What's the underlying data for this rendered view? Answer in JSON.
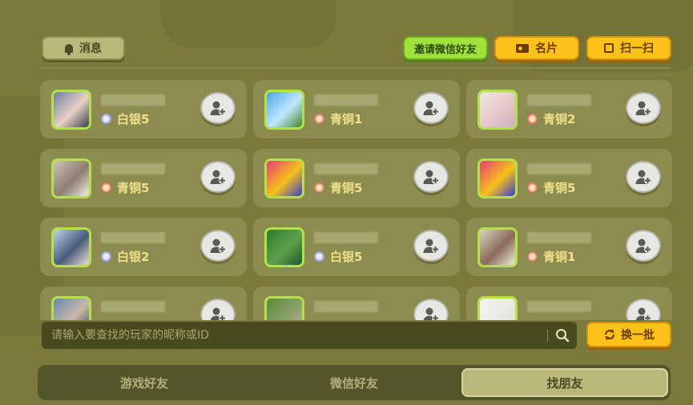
{
  "header": {
    "message_label": "消息",
    "invite_wechat_label": "邀请微信好友",
    "card_label": "名片",
    "scan_label": "扫一扫"
  },
  "friends": [
    {
      "rank": "白银5",
      "rank_type": "silver",
      "avatar_colors": [
        "#6e7fa2",
        "#e8d0c4",
        "#3b3d4d"
      ]
    },
    {
      "rank": "青铜1",
      "rank_type": "bronze",
      "avatar_colors": [
        "#4aa6e8",
        "#bfe8ff",
        "#3f8a2a"
      ]
    },
    {
      "rank": "青铜2",
      "rank_type": "bronze",
      "avatar_colors": [
        "#f0e8e4",
        "#e8c8c8",
        "#c8b0c0"
      ]
    },
    {
      "rank": "青铜5",
      "rank_type": "bronze",
      "avatar_colors": [
        "#cfc5b8",
        "#8c7e70",
        "#f2ece6"
      ]
    },
    {
      "rank": "青铜5",
      "rank_type": "bronze",
      "avatar_colors": [
        "#e83a7a",
        "#f6c21a",
        "#3a3ad0"
      ]
    },
    {
      "rank": "青铜5",
      "rank_type": "bronze",
      "avatar_colors": [
        "#e83a7a",
        "#f6c21a",
        "#3a3ad0"
      ]
    },
    {
      "rank": "白银2",
      "rank_type": "silver",
      "avatar_colors": [
        "#bcd8ec",
        "#4a5a7a",
        "#e8e0d8"
      ]
    },
    {
      "rank": "白银5",
      "rank_type": "silver",
      "avatar_colors": [
        "#2e7a2e",
        "#5ea04a",
        "#1e5a2a"
      ]
    },
    {
      "rank": "青铜1",
      "rank_type": "bronze",
      "avatar_colors": [
        "#dcd4c4",
        "#8a6a5a",
        "#f2eedc"
      ]
    },
    {
      "rank": "",
      "rank_type": "silver",
      "avatar_colors": [
        "#6a8ab0",
        "#c8b8a8",
        "#3a4a5a"
      ]
    },
    {
      "rank": "",
      "rank_type": "bronze",
      "avatar_colors": [
        "#5a8a3a",
        "#8aa06a",
        "#c8b89a"
      ]
    },
    {
      "rank": "",
      "rank_type": "bronze",
      "avatar_colors": [
        "#f4f4f2",
        "#e8e8e4",
        "#dcdcd8"
      ]
    }
  ],
  "search": {
    "placeholder": "请输入要查找的玩家的昵称或ID",
    "value": ""
  },
  "refresh_label": "换一批",
  "tabs": [
    {
      "label": "游戏好友",
      "active": false
    },
    {
      "label": "微信好友",
      "active": false
    },
    {
      "label": "找朋友",
      "active": true
    }
  ],
  "colors": {
    "background": "#7b7a3c",
    "card": "#8d8c50",
    "rank_text": "#efe08a",
    "accent_yellow": "#fbc21a",
    "accent_green": "#9fe03a"
  }
}
